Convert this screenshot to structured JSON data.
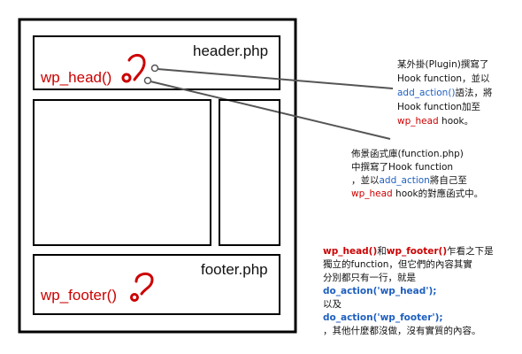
{
  "page": {
    "header_label": "header.php",
    "wp_head_label": "wp_head()",
    "footer_label": "footer.php",
    "wp_footer_label": "wp_footer()"
  },
  "callout_plugin": {
    "line1": "某外掛(Plugin)撰寫了",
    "line2": "Hook function，並以",
    "line3_code": "add_action()",
    "line3_rest": "語法，將",
    "line4": "Hook function加至",
    "line5_code": "wp_head",
    "line5_rest": " hook。"
  },
  "callout_functions": {
    "line1": "佈景函式庫(function.php)",
    "line2": "中撰寫了Hook function",
    "line3_pre": "，並以",
    "line3_code": "add_action",
    "line3_rest": "將自己至",
    "line4_code": "wp_head",
    "line4_rest": " hook的對應函式中。"
  },
  "explanation": {
    "l1_a": "wp_head()",
    "l1_b": "和",
    "l1_c": "wp_footer()",
    "l1_d": "乍看之下是",
    "l2": "獨立的function，但它們的內容其實",
    "l3": "分別都只有一行，就是",
    "l4": "do_action('wp_head');",
    "l5": "以及",
    "l6": "do_action('wp_footer');",
    "l7": "，其他什麼都沒做，沒有實質的內容。"
  },
  "colors": {
    "accent_red": "#cc0000",
    "code_blue": "#1e5fbf",
    "line_gray": "#555555"
  },
  "icons": [
    "hook-icon-head",
    "hook-icon-footer"
  ]
}
